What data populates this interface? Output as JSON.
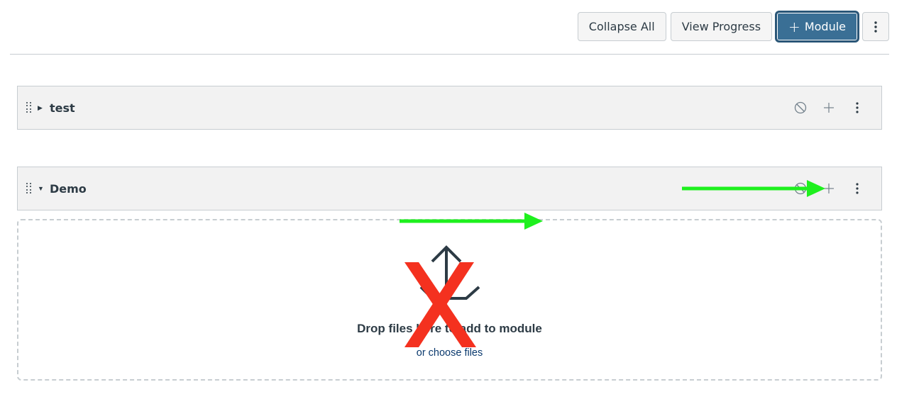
{
  "toolbar": {
    "collapse_all": "Collapse All",
    "view_progress": "View Progress",
    "add_module_plus": "+",
    "add_module_label": "Module",
    "more_icon": "kebab-menu-icon"
  },
  "modules": [
    {
      "title": "test",
      "expanded": false,
      "actions": [
        "publish-status-icon",
        "add-item-icon",
        "kebab-menu-icon"
      ]
    },
    {
      "title": "Demo",
      "expanded": true,
      "actions": [
        "publish-status-icon",
        "add-item-icon",
        "kebab-menu-icon"
      ]
    }
  ],
  "dropzone": {
    "icon": "upload-icon",
    "text": "Drop files here to add to module",
    "link": "or choose files"
  },
  "annotations": {
    "arrow_color": "#1ef01e",
    "x_mark_color": "#f4311f"
  },
  "colors": {
    "primary_button": "#3a6f95",
    "module_header_bg": "#f2f2f2",
    "border": "#c7cdd1",
    "text": "#2d3b45",
    "link": "#0b3a6e"
  }
}
